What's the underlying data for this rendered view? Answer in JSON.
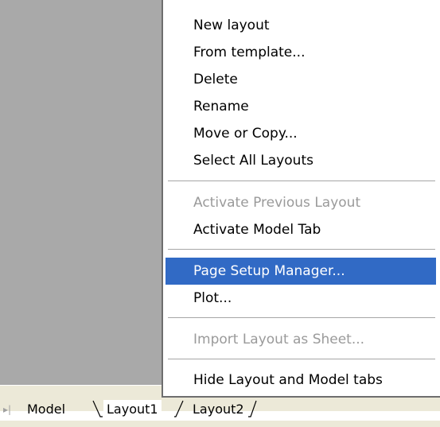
{
  "context_menu": {
    "items": [
      {
        "label": "New layout",
        "enabled": true,
        "highlighted": false
      },
      {
        "label": "From template...",
        "enabled": true,
        "highlighted": false
      },
      {
        "label": "Delete",
        "enabled": true,
        "highlighted": false
      },
      {
        "label": "Rename",
        "enabled": true,
        "highlighted": false
      },
      {
        "label": "Move or Copy...",
        "enabled": true,
        "highlighted": false
      },
      {
        "label": "Select All Layouts",
        "enabled": true,
        "highlighted": false
      },
      {
        "label": "Activate Previous Layout",
        "enabled": false,
        "highlighted": false
      },
      {
        "label": "Activate Model Tab",
        "enabled": true,
        "highlighted": false
      },
      {
        "label": "Page Setup Manager...",
        "enabled": true,
        "highlighted": true
      },
      {
        "label": "Plot...",
        "enabled": true,
        "highlighted": false
      },
      {
        "label": "Import Layout as Sheet...",
        "enabled": false,
        "highlighted": false
      },
      {
        "label": "Hide Layout and Model tabs",
        "enabled": true,
        "highlighted": false
      }
    ]
  },
  "layout_tabs": {
    "tabs": [
      {
        "label": "Model",
        "active": false
      },
      {
        "label": "Layout1",
        "active": true
      },
      {
        "label": "Layout2",
        "active": false
      }
    ]
  },
  "colors": {
    "highlight": "#316ac5",
    "canvas": "#a9a9a9",
    "disabled_text": "#9a9a9a"
  }
}
